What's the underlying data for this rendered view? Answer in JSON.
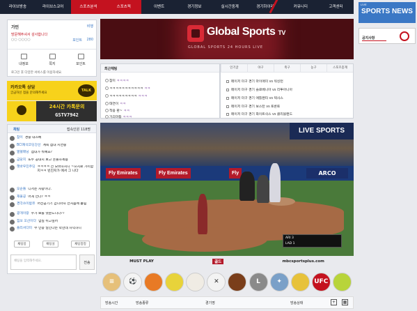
{
  "nav": {
    "items": [
      {
        "label": "라이브방송",
        "active": false
      },
      {
        "label": "라이브스코어",
        "active": false
      },
      {
        "label": "스포츠분석",
        "active": true
      },
      {
        "label": "스포츠픽",
        "active": true
      },
      {
        "label": "이벤트",
        "active": false
      },
      {
        "label": "경기정보",
        "active": false
      },
      {
        "label": "실시간중계",
        "active": false
      },
      {
        "label": "경기하이라",
        "active": false
      },
      {
        "label": "커뮤니티",
        "active": false
      },
      {
        "label": "고객센터",
        "active": false
      }
    ]
  },
  "right_ads": {
    "logo_text": "SPORTS NEWS",
    "logo_tag": "LIVE",
    "ad_label": "공지사항"
  },
  "login": {
    "name": "가민",
    "level_label": "비행",
    "greeting": "방문해주셔서 감사합니다",
    "sub": "○○ ○○○○",
    "points_label": "포인트",
    "points_value": "280",
    "quick": [
      "내정보",
      "쪽지",
      "포인트"
    ],
    "notice": "로그인 후 다양한 서비스를 이용하세요."
  },
  "kakao": {
    "title": "카카오톡 상담",
    "sub": "궁금하신 점을 문의해주세요",
    "talk": "TALK",
    "line1": "24시간 카톡문의",
    "line2": "GSTV7942"
  },
  "chat": {
    "title": "채팅",
    "count": "접속인원 118명",
    "messages": [
      {
        "user": "참이",
        "text": "경중 대스베"
      },
      {
        "user": "BCI재석코딩강선",
        "text": "계속 점대 시면중"
      },
      {
        "user": "열혈매닝",
        "text": "점대가 뭐예요?"
      },
      {
        "user": "금당지",
        "text": "또두 공대지 보고 흔들하세용"
      },
      {
        "user": "햇바우진주딩",
        "text": "ㅋㅋㅋㅋ 전 오바하지니 ~으지로 가이함지ㅋㅋ 빈진지가 에서 그 니다"
      },
      {
        "user": "오순들",
        "text": "디저는 사랑이다."
      },
      {
        "user": "재울공",
        "text": "어게 언다? ㅋㅋ"
      },
      {
        "user": "경각쓰이밤유",
        "text": "어전공기기 겁니마자 전처음에 흘림"
      },
      {
        "user": "광개이랑",
        "text": "수가 보를 멋분드니다??"
      },
      {
        "user": "힘쏘 꼬산이다",
        "text": "엄실 쉬고싶어"
      },
      {
        "user": "플리서다미",
        "text": "무 인증 일인다는 막한데 차익하니"
      }
    ],
    "actions": [
      "채팅방",
      "채팅설",
      "채팅창정"
    ],
    "input_placeholder": "채팅을 입력해주세요.",
    "send": "전송"
  },
  "banner": {
    "title": "Global Sports",
    "tv": "TV",
    "subtitle": "GLOBAL SPORTS 24 HOURS LIVE"
  },
  "poll": {
    "title": "최근채팅",
    "lines": [
      {
        "text": "참이",
        "dots": "ㅋㅋㅋㅋ"
      },
      {
        "text": "ㅋㅋㅋㅋㅋㅋㅋㅋㅋㅋㅋ",
        "dots": "ㅋㅋ"
      },
      {
        "text": "ㅋㅋㅋㅋㅋㅋㅋㅋㅋ",
        "dots": "ㅋㅋㅋ"
      },
      {
        "text": "태연이",
        "dots": "ㅋㅋ"
      },
      {
        "text": "적용 환~",
        "dots": "ㅋㅋ"
      },
      {
        "text": "가괴마등",
        "dots": "ㅋㅋㅋ"
      }
    ]
  },
  "schedule": {
    "tabs": [
      "인기글",
      "야구",
      "축구",
      "농구",
      "스포츠중계"
    ],
    "games": [
      "메이저 미구 경기 마이애미 vs 워싱턴",
      "메이저 미구 경기 슬로베니아 vs 리투아니아",
      "메이저 미구 경기 애틀랜타 vs 텍사스",
      "메이저 미구 경기 보스턴 vs 토론토",
      "메이저 미구 경기 화이트삭스 vs 클리블랜드"
    ]
  },
  "video": {
    "live_label": "LIVE SPORTS",
    "ads": [
      "Fly Emirates",
      "Fly Emirates",
      "Fly"
    ],
    "arco": "ARCO",
    "score_row1": "ARI  3",
    "score_row2": "LAD  1",
    "bottom": [
      "MUST PLAY",
      "골드",
      "mbcsportsplus.com"
    ]
  },
  "icons": [
    {
      "name": "schedule-icon",
      "color": "#e6c07a",
      "glyph": "≡"
    },
    {
      "name": "soccer-ball-icon",
      "color": "#f4f4f4",
      "glyph": "⚽"
    },
    {
      "name": "basketball-icon",
      "color": "#e87a25",
      "glyph": ""
    },
    {
      "name": "tennis-ball-icon",
      "color": "#e8d33a",
      "glyph": ""
    },
    {
      "name": "baseball-icon",
      "color": "#f0ece4",
      "glyph": ""
    },
    {
      "name": "hockey-icon",
      "color": "#f3f3f3",
      "glyph": "✕"
    },
    {
      "name": "football-icon",
      "color": "#7a3e1a",
      "glyph": ""
    },
    {
      "name": "lol-icon",
      "color": "#8a8a8a",
      "glyph": "L"
    },
    {
      "name": "esports-icon",
      "color": "#7aa0c8",
      "glyph": "✦"
    },
    {
      "name": "volleyball-icon",
      "color": "#e7c23a",
      "glyph": ""
    },
    {
      "name": "ufc-icon",
      "color": "#c4121f",
      "glyph": "UFC"
    },
    {
      "name": "tennis-icon",
      "color": "#b8d43a",
      "glyph": ""
    }
  ],
  "table": {
    "headers": [
      "방송시간",
      "방송종류",
      "경기명",
      "방송상태"
    ],
    "add_icon": "+",
    "grid_icon": "▦"
  }
}
